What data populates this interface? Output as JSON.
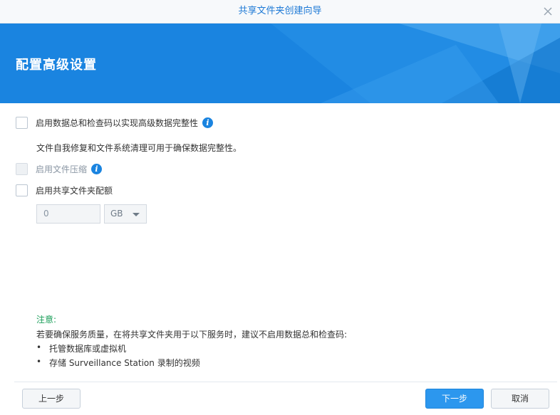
{
  "window": {
    "title": "共享文件夹创建向导"
  },
  "banner": {
    "heading": "配置高级设置"
  },
  "options": {
    "checksum_label": "启用数据总和检查码以实现高级数据完整性",
    "checksum_desc": "文件自我修复和文件系统清理可用于确保数据完整性。",
    "compression_label": "启用文件压缩",
    "quota_label": "启用共享文件夹配额",
    "quota_value": "0",
    "quota_unit": "GB"
  },
  "note": {
    "title": "注意:",
    "line": "若要确保服务质量，在将共享文件夹用于以下服务时，建议不启用数据总和检查码:",
    "bullet_symbol": "•",
    "items": [
      "托管数据库或虚拟机",
      "存储 Surveillance Station 录制的视频"
    ]
  },
  "footer": {
    "back_label": "上一步",
    "next_label": "下一步",
    "cancel_label": "取消"
  },
  "icons": {
    "info_glyph": "i"
  },
  "colors": {
    "accent": "#1a84e0",
    "note_title": "#1a9e59",
    "primary_button": "#2c97ee"
  }
}
